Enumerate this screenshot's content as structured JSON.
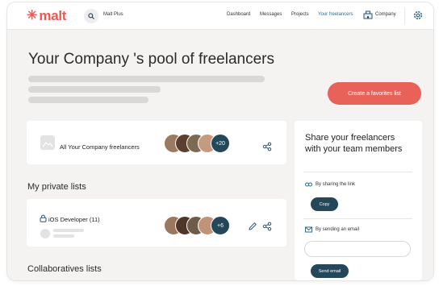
{
  "header": {
    "logo_mark": "✳",
    "logo_text": "malt",
    "search_label": "Malt Plus",
    "nav": [
      "Dashboard",
      "Messages",
      "Projects",
      "Your freelancers",
      "Company"
    ]
  },
  "main": {
    "title": "Your Company 's pool of freelancers",
    "favorites_button": "Create a favorites list",
    "all_card": {
      "title": "All Your Company freelancers",
      "more_count": "+20"
    },
    "private_section": "My private lists",
    "private_list": {
      "title": "iOS Developer (11)",
      "more_count": "+6"
    },
    "collab_section": "Collaboratives lists"
  },
  "share": {
    "title": "Share your freelancers with your team members",
    "by_link": "By sharing the link",
    "copy_button": "Copy",
    "by_email": "By sending an email",
    "send_button": "Send email"
  },
  "colors": {
    "brand": "#f0574f",
    "accent_dark": "#24485a",
    "favorites_button": "#e9625a",
    "active_nav": "#2f6a8a"
  }
}
